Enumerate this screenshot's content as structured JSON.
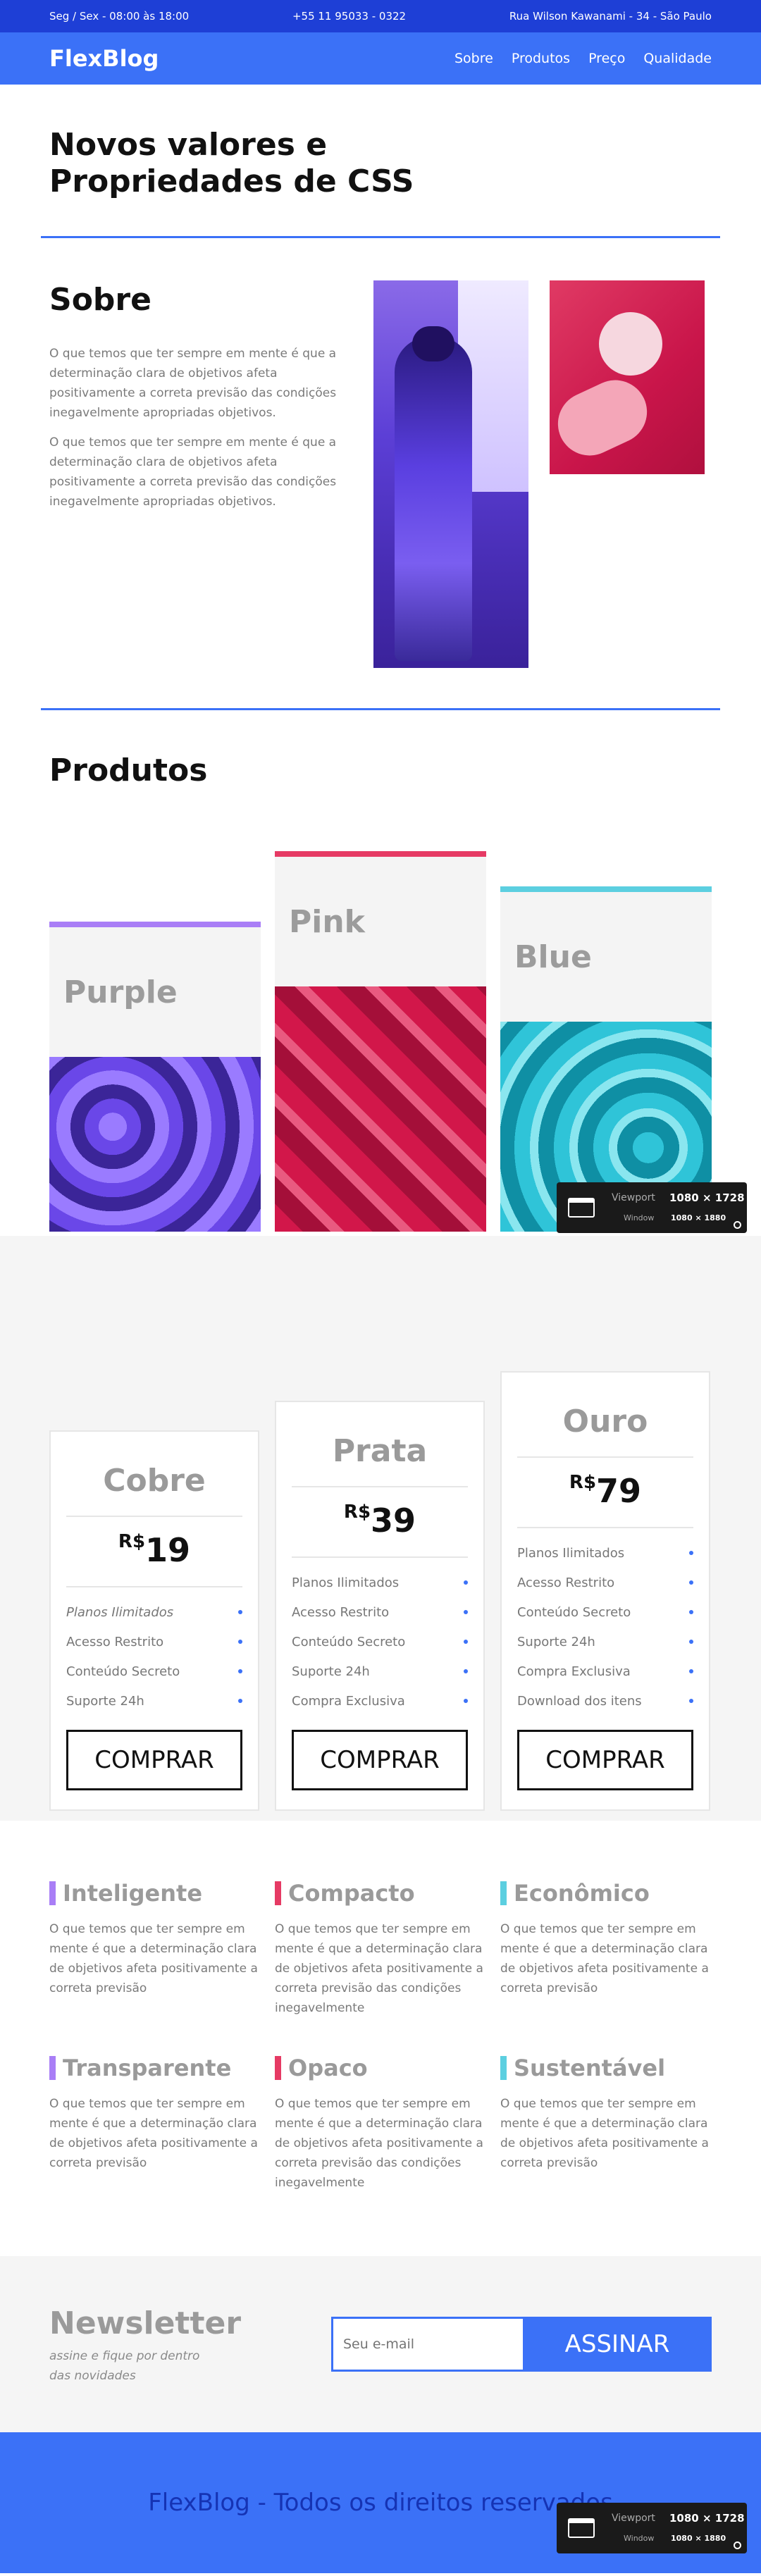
{
  "topbar": {
    "hours": "Seg / Sex - 08:00 às 18:00",
    "phone": "+55 11 95033 - 0322",
    "address": "Rua Wilson Kawanami - 34 - São Paulo"
  },
  "header": {
    "brand": "FlexBlog",
    "nav": [
      "Sobre",
      "Produtos",
      "Preço",
      "Qualidade"
    ]
  },
  "intro": {
    "title": "Novos valores e Propriedades de CSS"
  },
  "about": {
    "title": "Sobre",
    "paragraphs": [
      "O que temos que ter sempre em mente é que a determinação clara de objetivos afeta positivamente a correta previsão das condições inegavelmente apropriadas objetivos.",
      "O que temos que ter sempre em mente é que a determinação clara de objetivos afeta positivamente a correta previsão das condições inegavelmente apropriadas objetivos."
    ]
  },
  "products": {
    "title": "Produtos",
    "items": [
      {
        "name": "Purple",
        "color": "#a97ef6"
      },
      {
        "name": "Pink",
        "color": "#e63a64"
      },
      {
        "name": "Blue",
        "color": "#5ccfe0"
      }
    ]
  },
  "viewport_widget": {
    "viewport_label": "Viewport",
    "viewport_value": "1080 × 1728",
    "window_label": "Window",
    "window_value": "1080 × 1880"
  },
  "pricing": {
    "currency": "R$",
    "buy_label": "COMPRAR",
    "plans": [
      {
        "name": "Cobre",
        "price": "19",
        "features": [
          "Planos Ilimitados",
          "Acesso Restrito",
          "Conteúdo Secreto",
          "Suporte 24h"
        ]
      },
      {
        "name": "Prata",
        "price": "39",
        "features": [
          "Planos Ilimitados",
          "Acesso Restrito",
          "Conteúdo Secreto",
          "Suporte 24h",
          "Compra Exclusiva"
        ]
      },
      {
        "name": "Ouro",
        "price": "79",
        "features": [
          "Planos Ilimitados",
          "Acesso Restrito",
          "Conteúdo Secreto",
          "Suporte 24h",
          "Compra Exclusiva",
          "Download dos itens"
        ]
      }
    ]
  },
  "features": [
    {
      "title": "Inteligente",
      "color": "#a97ef6",
      "text": "O que temos que ter sempre em mente é que a determinação clara de objetivos afeta positivamente a correta previsão"
    },
    {
      "title": "Compacto",
      "color": "#e63a64",
      "text": "O que temos que ter sempre em mente é que a determinação clara de objetivos afeta positivamente a correta previsão das condições inegavelmente"
    },
    {
      "title": "Econômico",
      "color": "#5ccfe0",
      "text": "O que temos que ter sempre em mente é que a determinação clara de objetivos afeta positivamente a correta previsão"
    },
    {
      "title": "Transparente",
      "color": "#a97ef6",
      "text": "O que temos que ter sempre em mente é que a determinação clara de objetivos afeta positivamente a correta previsão"
    },
    {
      "title": "Opaco",
      "color": "#e63a64",
      "text": "O que temos que ter sempre em mente é que a determinação clara de objetivos afeta positivamente a correta previsão das condições inegavelmente"
    },
    {
      "title": "Sustentável",
      "color": "#5ccfe0",
      "text": "O que temos que ter sempre em mente é que a determinação clara de objetivos afeta positivamente a correta previsão"
    }
  ],
  "newsletter": {
    "title": "Newsletter",
    "subtitle": "assine e fique por dentro das novidades",
    "placeholder": "Seu e-mail",
    "button": "ASSINAR"
  },
  "footer": {
    "text": "FlexBlog - Todos os direitos reservados"
  },
  "colors": {
    "primary": "#3b71f7",
    "topbar": "#1e3fd6",
    "purple": "#a97ef6",
    "pink": "#e63a64",
    "blue": "#5ccfe0"
  }
}
